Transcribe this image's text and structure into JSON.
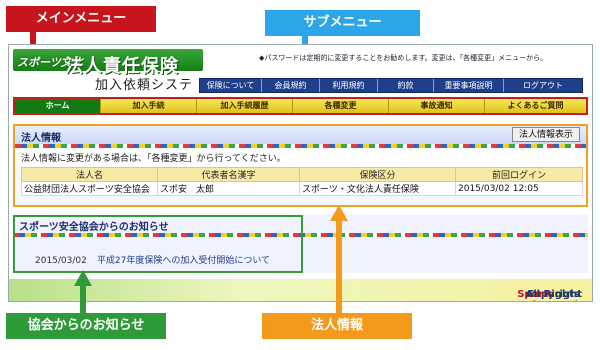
{
  "callouts": {
    "main_menu": "メインメニュー",
    "sub_menu": "サブメニュー",
    "association_notice": "協会からのお知らせ",
    "corporate_info": "法人情報"
  },
  "header": {
    "logo_sports": "スポーツ文化",
    "logo_title": "法人責任保険",
    "logo_subtitle": "加入依頼システム",
    "notice": "◆パスワードは定期的に変更することをお勧めします。変更は、「各種変更」メニューから。"
  },
  "sub_nav": [
    "保険について",
    "会員規約",
    "利用規約",
    "約款",
    "重要事項説明",
    "ログアウト"
  ],
  "main_nav": [
    "ホーム",
    "加入手続",
    "加入手続履歴",
    "各種変更",
    "事故通知",
    "よくあるご質問"
  ],
  "corp": {
    "title": "法人情報",
    "button": "法人情報表示",
    "message": "法人情報に変更がある場合は、「各種変更」から行ってください。",
    "columns": [
      "法人名",
      "代表者名漢字",
      "保険区分",
      "前回ログイン"
    ],
    "row": [
      "公益財団法人スポーツ安全協会",
      "スポ安　太郎",
      "スポーツ・文化法人責任保険",
      "2015/03/02 12:05"
    ]
  },
  "news": {
    "title": "スポーツ安全協会からのお知らせ",
    "date": "2015/03/02",
    "text": "平成27年度保険への加入受付開始について"
  },
  "footer": {
    "prefix": "Copyright 2015. The ",
    "org": "Sports Safety Association",
    "suffix": " All Rights Reserved."
  },
  "colors": {
    "main_menu": "#c8141c",
    "sub_menu": "#2ba6e8",
    "association_notice": "#2e9a3a",
    "corporate_info": "#f39a1c"
  }
}
